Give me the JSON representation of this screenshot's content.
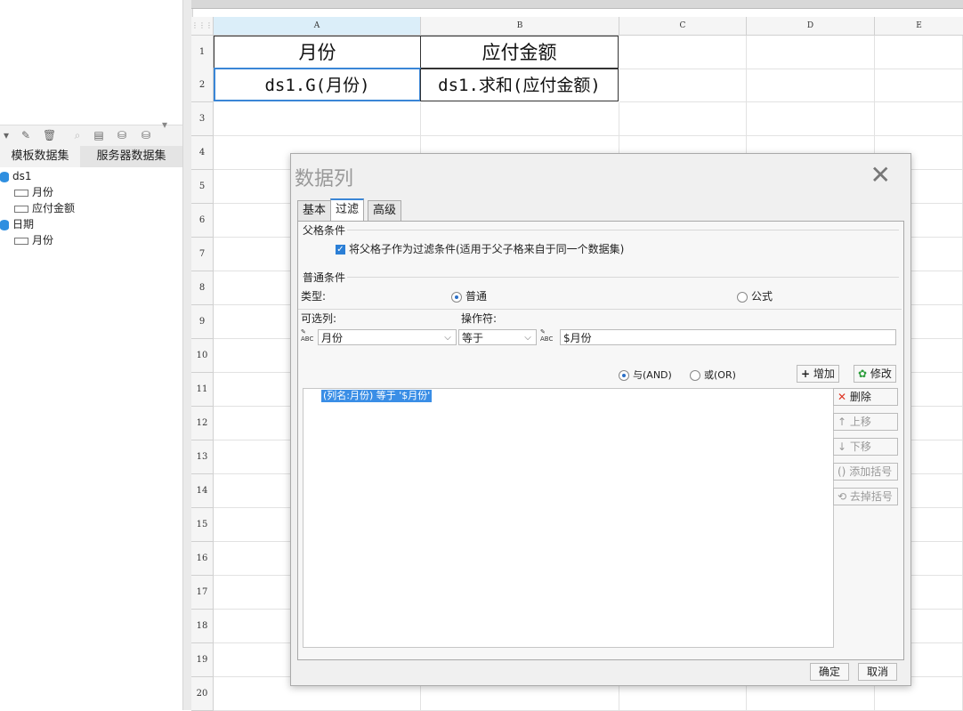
{
  "left_panel": {
    "tabs": [
      "模板数据集",
      "服务器数据集"
    ],
    "tree": [
      {
        "label": "ds1",
        "type": "dataset"
      },
      {
        "label": "月份",
        "type": "field"
      },
      {
        "label": "应付金额",
        "type": "field"
      },
      {
        "label": "日期",
        "type": "dataset"
      },
      {
        "label": "月份",
        "type": "field"
      }
    ]
  },
  "spreadsheet": {
    "columns": [
      "A",
      "B",
      "C",
      "D",
      "E"
    ],
    "rows": [
      "1",
      "2",
      "3",
      "4",
      "5",
      "6",
      "7",
      "8",
      "9",
      "10",
      "11",
      "12",
      "13",
      "14",
      "15",
      "16",
      "17",
      "18",
      "19",
      "20"
    ],
    "cells": {
      "A1": "月份",
      "B1": "应付金额",
      "A2": "ds1.G(月份)",
      "B2": "ds1.求和(应付金额)"
    }
  },
  "dialog": {
    "title": "数据列",
    "tabs": [
      "基本",
      "过滤",
      "高级"
    ],
    "active_tab": "过滤",
    "parent_condition_section": "父格条件",
    "parent_checkbox_label": "将父格子作为过滤条件(适用于父子格来自于同一个数据集)",
    "normal_condition_section": "普通条件",
    "type_label": "类型:",
    "type_options": [
      "普通",
      "公式"
    ],
    "type_selected": "普通",
    "column_label": "可选列:",
    "operator_label": "操作符:",
    "column_value": "月份",
    "operator_value": "等于",
    "value_field": "$月份",
    "logic_and": "与(AND)",
    "logic_or": "或(OR)",
    "add_button": "增加",
    "modify_button": "修改",
    "delete_button": "删除",
    "up_button": "上移",
    "down_button": "下移",
    "add_bracket_button": "添加括号",
    "remove_bracket_button": "去掉括号",
    "condition_item": "(列名:月份) 等于 '$月份'",
    "ok_button": "确定",
    "cancel_button": "取消"
  },
  "colors": {
    "accent": "#2b7fd6",
    "selection": "#3a8ee6"
  }
}
